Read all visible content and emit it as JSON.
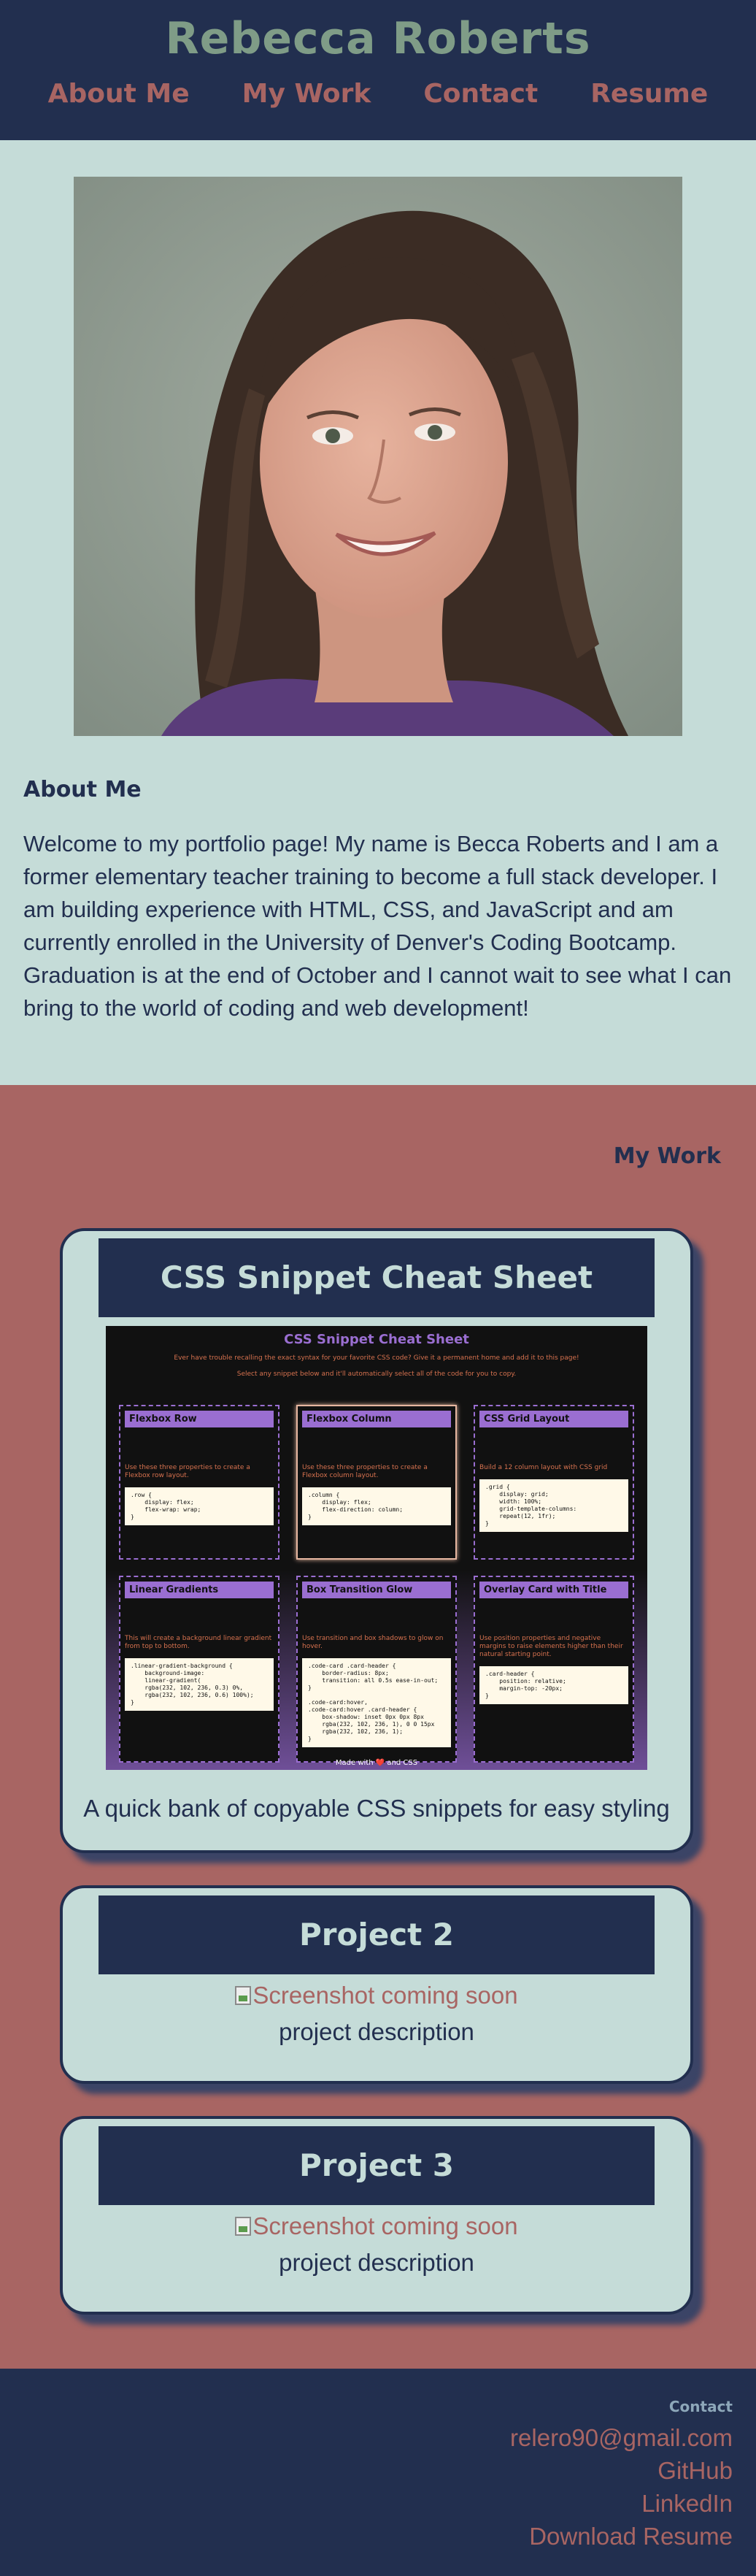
{
  "header": {
    "title": "Rebecca Roberts",
    "nav": [
      "About Me",
      "My Work",
      "Contact",
      "Resume"
    ]
  },
  "about": {
    "heading": "About Me",
    "text": "Welcome to my portfolio page! My name is Becca Roberts and I am a former elementary teacher training to become a full stack developer. I am building experience with HTML, CSS, and JavaScript and am currently enrolled in the University of Denver's Coding Bootcamp. Graduation is at the end of October and I cannot wait to see what I can bring to the world of coding and web development!"
  },
  "work": {
    "heading": "My Work",
    "projects": [
      {
        "title": "CSS Snippet Cheat Sheet",
        "description": "A quick bank of copyable CSS snippets for easy styling",
        "screenshot": {
          "title": "CSS Snippet Cheat Sheet",
          "subtitle": "Ever have trouble recalling the exact syntax for your favorite CSS code? Give it a permanent home and add it to this page!",
          "instruction": "Select any snippet below and it'll automatically select all of the code for you to copy.",
          "footer_text": "Made with",
          "footer_heart": "❤️",
          "footer_end": "and CSS",
          "cards": [
            {
              "title": "Flexbox Row",
              "desc": "Use these three properties to create a Flexbox row layout.",
              "code": ".row {\n    display: flex;\n    flex-wrap: wrap;\n}"
            },
            {
              "title": "Flexbox Column",
              "desc": "Use these three properties to create a Flexbox column layout.",
              "code": ".column {\n    display: flex;\n    flex-direction: column;\n}"
            },
            {
              "title": "CSS Grid Layout",
              "desc": "Build a 12 column layout with CSS grid",
              "code": ".grid {\n    display: grid;\n    width: 100%;\n    grid-template-columns:\n    repeat(12, 1fr);\n}"
            },
            {
              "title": "Linear Gradients",
              "desc": "This will create a background linear gradient from top to bottom.",
              "code": ".linear-gradient-background {\n    background-image:\n    linear-gradient(\n    rgba(232, 102, 236, 0.3) 0%,\n    rgba(232, 102, 236, 0.6) 100%);\n}"
            },
            {
              "title": "Box Transition Glow",
              "desc": "Use transition and box shadows to glow on hover.",
              "code": ".code-card .card-header {\n    border-radius: 8px;\n    transition: all 0.5s ease-in-out;\n}\n\n.code-card:hover,\n.code-card:hover .card-header {\n    box-shadow: inset 0px 0px 8px\n    rgba(232, 102, 236, 1), 0 0 15px\n    rgba(232, 102, 236, 1);\n}"
            },
            {
              "title": "Overlay Card with Title",
              "desc": "Use position properties and negative margins to raise elements higher than their natural starting point.",
              "code": ".card-header {\n    position: relative;\n    margin-top: -20px;\n}"
            }
          ]
        }
      },
      {
        "title": "Project 2",
        "image_alt": "Screenshot coming soon",
        "description": "project description"
      },
      {
        "title": "Project 3",
        "image_alt": "Screenshot coming soon",
        "description": "project description"
      }
    ]
  },
  "footer": {
    "heading": "Contact",
    "links": [
      "relero90@gmail.com",
      "GitHub",
      "LinkedIn",
      "Download Resume"
    ]
  },
  "colors": {
    "navy": "#222f4f",
    "sage": "#7f9c87",
    "rose": "#a86563",
    "mint": "#c5dcd8",
    "purple": "#9a6ed1"
  }
}
